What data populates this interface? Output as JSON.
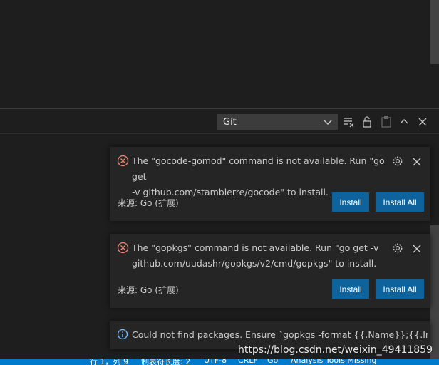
{
  "panel": {
    "output_channel": "Git"
  },
  "notifications": [
    {
      "type": "error",
      "message_line1": "The \"gocode-gomod\" command is not available. Run \"go get",
      "message_line2": "-v github.com/stamblerre/gocode\" to install.",
      "source": "来源: Go (扩展)",
      "buttons": [
        "Install",
        "Install All"
      ]
    },
    {
      "type": "error",
      "message_line1": "The \"gopkgs\" command is not available. Run \"go get -v",
      "message_line2": "github.com/uudashr/gopkgs/v2/cmd/gopkgs\" to install.",
      "source": "来源: Go (扩展)",
      "buttons": [
        "Install",
        "Install All"
      ]
    },
    {
      "type": "info",
      "message_line1": "Could not find packages. Ensure `gopkgs -format {{.Name}};{{.ImportPa..."
    }
  ],
  "statusbar": {
    "items": [
      "行 1，列 9",
      "制表符长度: 2",
      "UTF-8",
      "CRLF",
      "Go",
      "Analysis Tools Missing"
    ]
  },
  "watermark": "https://blog.csdn.net/weixin_49411859",
  "colors": {
    "accent": "#0e639c",
    "statusbar": "#007acc",
    "error": "#f48771",
    "info": "#75beff"
  },
  "icons": [
    "clear-output-icon",
    "lock-scroll-icon",
    "copy-icon",
    "maximize-panel-icon",
    "close-panel-icon",
    "error-icon",
    "info-icon",
    "gear-icon",
    "close-icon",
    "chevron-down-icon"
  ]
}
